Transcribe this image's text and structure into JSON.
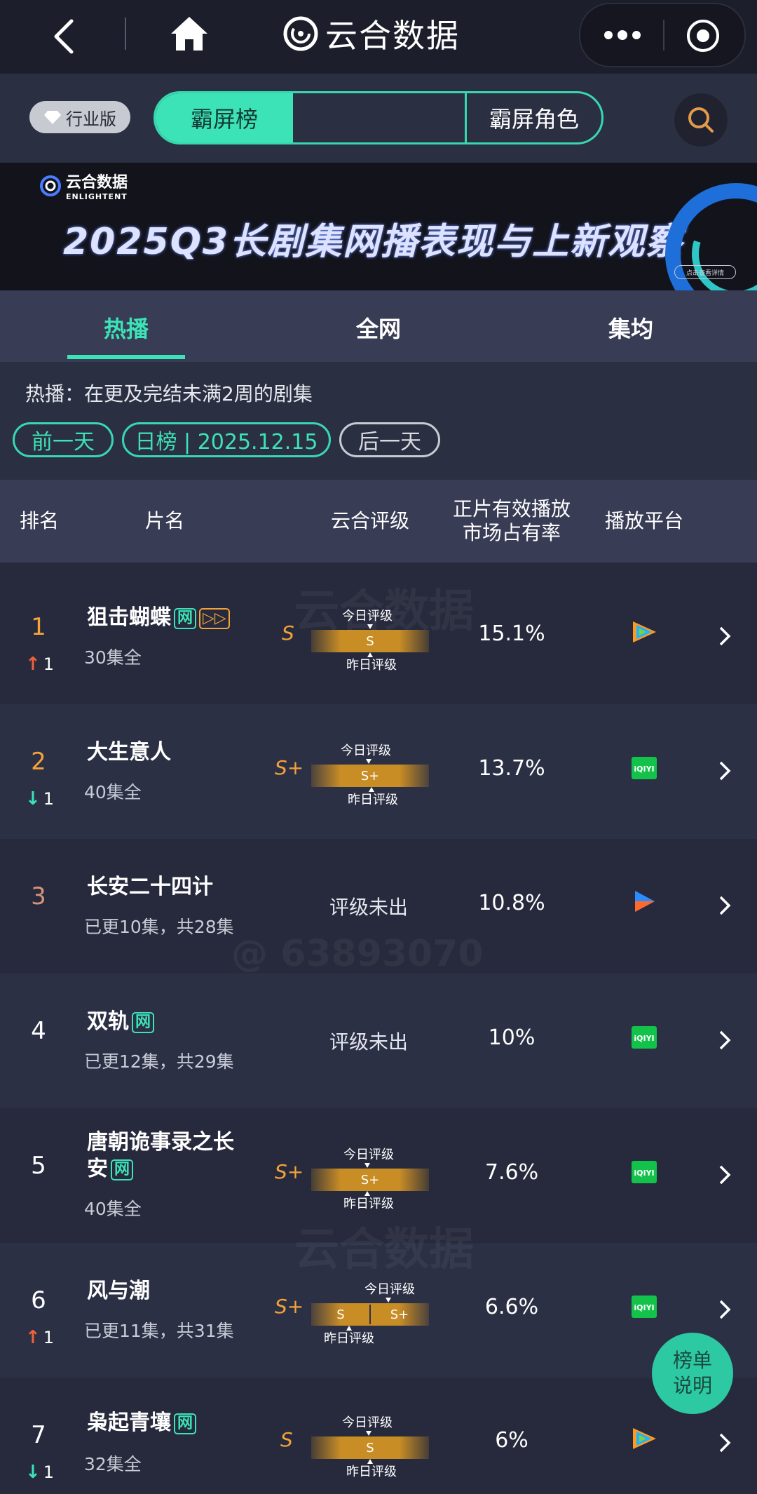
{
  "nav": {
    "brand": "云合数据"
  },
  "toolbar": {
    "edition": "行业版",
    "segments": [
      "霸屏榜",
      "",
      "霸屏角色"
    ]
  },
  "banner": {
    "logo_cn": "云合数据",
    "logo_en": "ENLIGHTENT",
    "title": "2025Q3长剧集网播表现与上新观察",
    "button": "点击查看详情"
  },
  "tabs": [
    "热播",
    "全网",
    "集均"
  ],
  "info": {
    "description": "热播：在更及完结未满2周的剧集",
    "prev": "前一天",
    "date": "日榜 | 2025.12.15",
    "next": "后一天"
  },
  "table": {
    "headers": {
      "rank": "排名",
      "title": "片名",
      "grade": "云合评级",
      "share_line1": "正片有效播放",
      "share_line2": "市场占有率",
      "platform": "播放平台"
    },
    "grade_today": "今日评级",
    "grade_yesterday": "昨日评级",
    "rows": [
      {
        "rank": "1",
        "change": "1",
        "title": "狙击蝴蝶",
        "tag": "网",
        "sub": "30集全",
        "grade": "S",
        "grade_bar": "S",
        "share": "15.1%",
        "platform": "tencent-video"
      },
      {
        "rank": "2",
        "change": "1",
        "title": "大生意人",
        "sub": "40集全",
        "grade": "S+",
        "grade_bar": "S+",
        "share": "13.7%",
        "platform": "iqiyi"
      },
      {
        "rank": "3",
        "title": "长安二十四计",
        "sub": "已更10集，共28集",
        "nograde": "评级未出",
        "share": "10.8%",
        "platform": "youku"
      },
      {
        "rank": "4",
        "title": "双轨",
        "tag": "网",
        "sub": "已更12集，共29集",
        "nograde": "评级未出",
        "share": "10%",
        "platform": "iqiyi"
      },
      {
        "rank": "5",
        "title_line1": "唐朝诡事录之长",
        "title_line2": "安",
        "tag": "网",
        "sub": "40集全",
        "grade": "S+",
        "grade_bar": "S+",
        "share": "7.6%",
        "platform": "iqiyi"
      },
      {
        "rank": "6",
        "change": "1",
        "title": "风与潮",
        "sub": "已更11集，共31集",
        "grade": "S+",
        "grade_left": "S",
        "grade_right": "S+",
        "share": "6.6%",
        "platform": "iqiyi"
      },
      {
        "rank": "7",
        "change": "1",
        "title": "枭起青壤",
        "tag": "网",
        "sub": "32集全",
        "grade": "S",
        "grade_bar": "S",
        "share": "6%",
        "platform": "tencent-video"
      }
    ]
  },
  "float_button": {
    "line1": "榜单",
    "line2": "说明"
  },
  "watermark": {
    "cn": "云合数据",
    "en": "ENLIGHTENT",
    "id": "@ 63893070"
  }
}
